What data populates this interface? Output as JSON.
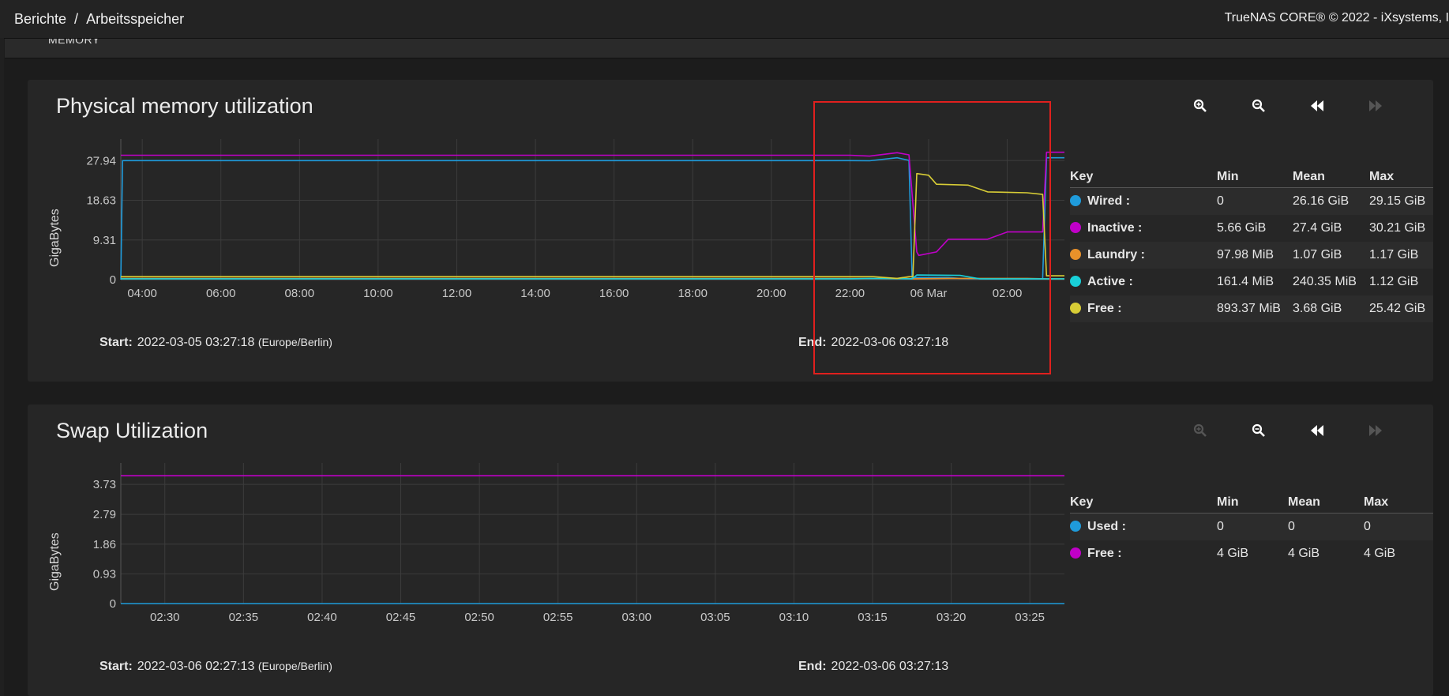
{
  "breadcrumb": {
    "parent": "Berichte",
    "separator": "/",
    "current": "Arbeitsspeicher"
  },
  "copyright": "TrueNAS CORE® © 2022 - iXsystems, I",
  "subheader": "MEMORY",
  "colors": {
    "wired": "#1f9bdb",
    "inactive": "#c000c8",
    "laundry": "#e8912a",
    "active": "#19d0d8",
    "free": "#d8cd36",
    "used": "#1f9bdb"
  },
  "toolbar_icons": [
    "zoom-in-icon",
    "zoom-out-icon",
    "rewind-icon",
    "fast-forward-icon"
  ],
  "physical": {
    "title": "Physical memory utilization",
    "ylabel": "GigaBytes",
    "start_label": "Start:",
    "start_value": "2022-03-05 03:27:18",
    "start_tz": "(Europe/Berlin)",
    "end_label": "End:",
    "end_value": "2022-03-06 03:27:18",
    "legend": {
      "headers": [
        "Key",
        "Min",
        "Mean",
        "Max"
      ],
      "rows": [
        {
          "name": "Wired :",
          "min": "0",
          "mean": "26.16 GiB",
          "max": "29.15 GiB"
        },
        {
          "name": "Inactive :",
          "min": "5.66 GiB",
          "mean": "27.4 GiB",
          "max": "30.21 GiB"
        },
        {
          "name": "Laundry :",
          "min": "97.98 MiB",
          "mean": "1.07 GiB",
          "max": "1.17 GiB"
        },
        {
          "name": "Active :",
          "min": "161.4 MiB",
          "mean": "240.35 MiB",
          "max": "1.12 GiB"
        },
        {
          "name": "Free :",
          "min": "893.37 MiB",
          "mean": "3.68 GiB",
          "max": "25.42 GiB"
        }
      ]
    }
  },
  "swap": {
    "title": "Swap Utilization",
    "ylabel": "GigaBytes",
    "start_label": "Start:",
    "start_value": "2022-03-06 02:27:13",
    "start_tz": "(Europe/Berlin)",
    "end_label": "End:",
    "end_value": "2022-03-06 03:27:13",
    "legend": {
      "headers": [
        "Key",
        "Min",
        "Mean",
        "Max"
      ],
      "rows": [
        {
          "name": "Used :",
          "min": "0",
          "mean": "0",
          "max": "0"
        },
        {
          "name": "Free :",
          "min": "4 GiB",
          "mean": "4 GiB",
          "max": "4 GiB"
        }
      ]
    }
  },
  "chart_data": [
    {
      "type": "line",
      "title": "Physical memory utilization",
      "ylabel": "GigaBytes",
      "yticks": [
        0,
        9.31,
        18.63,
        27.94
      ],
      "ytick_labels": [
        "0",
        "9.31",
        "18.63",
        "27.94"
      ],
      "ylim": [
        0,
        33
      ],
      "xlim": [
        3.455,
        27.455
      ],
      "xtick_positions": [
        4,
        6,
        8,
        10,
        12,
        14,
        16,
        18,
        20,
        22,
        24,
        26
      ],
      "xtick_labels": [
        "04:00",
        "06:00",
        "08:00",
        "10:00",
        "12:00",
        "14:00",
        "16:00",
        "18:00",
        "20:00",
        "22:00",
        "06 Mar",
        "02:00"
      ],
      "grid": true,
      "series": [
        {
          "name": "Wired",
          "color": "#1f9bdb",
          "x": [
            3.455,
            3.5,
            22.0,
            22.5,
            23.2,
            23.5,
            23.58,
            24.5,
            24.8,
            25.5,
            26.5,
            26.9,
            27.0,
            27.455
          ],
          "y": [
            0,
            27.94,
            27.94,
            27.9,
            28.6,
            28.0,
            0.5,
            0.5,
            0.3,
            0.2,
            0.2,
            0.2,
            28.6,
            28.6
          ]
        },
        {
          "name": "Inactive",
          "color": "#c000c8",
          "x": [
            3.455,
            22.0,
            22.5,
            23.2,
            23.5,
            23.7,
            23.75,
            24.2,
            24.5,
            25.5,
            26.0,
            26.9,
            27.0,
            27.455
          ],
          "y": [
            29.2,
            29.2,
            29.0,
            29.8,
            29.3,
            6.5,
            5.7,
            6.5,
            9.5,
            9.5,
            11.2,
            11.2,
            29.9,
            29.9
          ]
        },
        {
          "name": "Laundry",
          "color": "#e8912a",
          "x": [
            3.455,
            22.0,
            23.5,
            23.6,
            24.5,
            25.5,
            26.5,
            27.0,
            27.455
          ],
          "y": [
            0.3,
            0.3,
            0.3,
            0.2,
            0.3,
            0.3,
            0.3,
            0.2,
            0.2
          ]
        },
        {
          "name": "Active",
          "color": "#19d0d8",
          "x": [
            3.455,
            22.0,
            22.5,
            23.58,
            23.7,
            24.8,
            25.3,
            27.0,
            27.455
          ],
          "y": [
            0.2,
            0.2,
            0.3,
            0.2,
            1.1,
            1.0,
            0.2,
            0.2,
            0.2
          ]
        },
        {
          "name": "Free",
          "color": "#d8cd36",
          "x": [
            3.455,
            22.0,
            22.6,
            23.2,
            23.5,
            23.6,
            23.7,
            24.0,
            24.2,
            25.0,
            25.5,
            26.5,
            26.9,
            27.0,
            27.455
          ],
          "y": [
            0.7,
            0.7,
            0.7,
            0.3,
            0.7,
            0.7,
            24.9,
            24.5,
            22.4,
            22.2,
            20.6,
            20.4,
            20.0,
            0.9,
            0.9
          ]
        }
      ]
    },
    {
      "type": "line",
      "title": "Swap Utilization",
      "ylabel": "GigaBytes",
      "yticks": [
        0,
        0.93,
        1.86,
        2.79,
        3.73
      ],
      "ytick_labels": [
        "0",
        "0.93",
        "1.86",
        "2.79",
        "3.73"
      ],
      "ylim": [
        0,
        4.4
      ],
      "xlim": [
        27.2,
        87.2
      ],
      "xtick_positions": [
        30,
        35,
        40,
        45,
        50,
        55,
        60,
        65,
        70,
        75,
        80,
        85
      ],
      "xtick_labels": [
        "02:30",
        "02:35",
        "02:40",
        "02:45",
        "02:50",
        "02:55",
        "03:00",
        "03:05",
        "03:10",
        "03:15",
        "03:20",
        "03:25"
      ],
      "grid": true,
      "series": [
        {
          "name": "Used",
          "color": "#1f9bdb",
          "x": [
            27.2,
            87.2
          ],
          "y": [
            0,
            0
          ]
        },
        {
          "name": "Free",
          "color": "#c000c8",
          "x": [
            27.2,
            87.2
          ],
          "y": [
            4.0,
            4.0
          ]
        }
      ]
    }
  ]
}
